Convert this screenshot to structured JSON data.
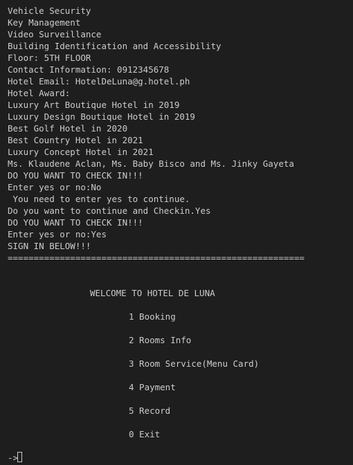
{
  "output": [
    "Vehicle Security",
    "Key Management",
    "Video Surveillance",
    "Building Identification and Accessibility",
    "Floor: 5TH FLOOR",
    "Contact Information: 0912345678",
    "Hotel Email: HotelDeLuna@g.hotel.ph",
    "Hotel Award:",
    "Luxury Art Boutique Hotel in 2019",
    "Luxury Design Boutique Hotel in 2019",
    "Best Golf Hotel in 2020",
    "Best Country Hotel in 2021",
    "Luxury Concept Hotel in 2021",
    "Ms. Klaudene Aclan, Ms. Baby Bisco and Ms. Jinky Gayeta",
    "DO YOU WANT TO CHECK IN!!!",
    "Enter yes or no:No",
    " You need to enter yes to continue.",
    "Do you want to continue and Checkin.Yes",
    "DO YOU WANT TO CHECK IN!!!",
    "Enter yes or no:Yes",
    "SIGN IN BELOW!!!",
    "========================================================="
  ],
  "menu": {
    "title": "WELCOME TO HOTEL DE LUNA",
    "items": [
      "1 Booking",
      "2 Rooms Info",
      "3 Room Service(Menu Card)",
      "4 Payment",
      "5 Record",
      "0 Exit"
    ]
  },
  "prompt": "->"
}
